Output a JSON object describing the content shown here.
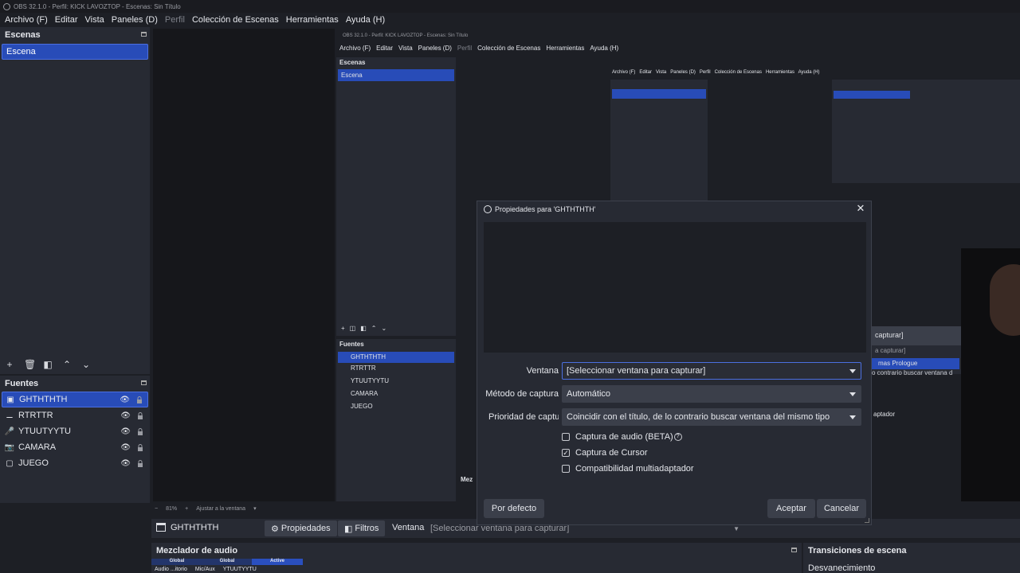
{
  "window_title": "OBS 32.1.0 - Perfil: KICK LAVOZTOP - Escenas: Sin Título",
  "menu": [
    "Archivo (F)",
    "Editar",
    "Vista",
    "Paneles (D)",
    "Perfil",
    "Colección de Escenas",
    "Herramientas",
    "Ayuda (H)"
  ],
  "scenes": {
    "title": "Escenas",
    "items": [
      "Escena"
    ]
  },
  "sources": {
    "title": "Fuentes",
    "items": [
      {
        "name": "GHTHTHTH",
        "icon": "window-icon",
        "selected": true
      },
      {
        "name": "RTRTTR",
        "icon": "gamepad-icon",
        "selected": false
      },
      {
        "name": "YTUUTYYTU",
        "icon": "microphone-icon",
        "selected": false
      },
      {
        "name": "CAMARA",
        "icon": "camera-icon",
        "selected": false
      },
      {
        "name": "JUEGO",
        "icon": "monitor-icon",
        "selected": false
      }
    ]
  },
  "nested": {
    "title": "OBS 32.1.0 - Perfil: KICK LAVOZTOP - Escenas: Sin Título",
    "menu": [
      "Archivo (F)",
      "Editar",
      "Vista",
      "Paneles (D)",
      "Perfil",
      "Colección de Escenas",
      "Herramientas",
      "Ayuda (H)"
    ],
    "scenes_title": "Escenas",
    "scene_item": "Escena",
    "sources_title": "Fuentes",
    "sources": [
      "GHTHTHTH",
      "RTRTTR",
      "YTUUTYYTU",
      "CAMARA",
      "JUEGO"
    ],
    "dropdown_fragment": "capturar]",
    "dropdown_option_1": "a capturar]",
    "dropdown_option_2": "mas Prologue",
    "dropdown_option_3": "o contrario buscar ventana d",
    "mixer_fragment": "Mez",
    "adapter_fragment": "aptador"
  },
  "dialog": {
    "title": "Propiedades para 'GHTHTHTH'",
    "fields": [
      {
        "label": "Ventana",
        "value": "[Seleccionar ventana para capturar]"
      },
      {
        "label": "Método de captura",
        "value": "Automático"
      },
      {
        "label": "Prioridad de captura",
        "value": "Coincidir con el título, de lo contrario buscar ventana del mismo tipo"
      }
    ],
    "checkboxes": [
      {
        "label": "Captura de audio (BETA)",
        "checked": false,
        "help": true
      },
      {
        "label": "Captura de Cursor",
        "checked": true,
        "help": false
      },
      {
        "label": "Compatibilidad multiadaptador",
        "checked": false,
        "help": false
      }
    ],
    "defaults_button": "Por defecto",
    "accept_button": "Aceptar",
    "cancel_button": "Cancelar"
  },
  "zoom": {
    "level": "81%",
    "fit": "Ajustar a la ventana"
  },
  "source_bar": {
    "name": "GHTHTHTH",
    "properties": "Propiedades",
    "filters": "Filtros",
    "window_label": "Ventana",
    "window_value": "[Seleccionar ventana para capturar]"
  },
  "mixer": {
    "title": "Mezclador de audio",
    "headers": [
      "Global",
      "Global",
      "Active"
    ],
    "channels": [
      "Audio ...itorio",
      "Mic/Aux",
      "YTUUTYYTU"
    ]
  },
  "transitions": {
    "title": "Transiciones de escena",
    "value": "Desvanecimiento"
  },
  "colors": {
    "accent": "#284cb8",
    "panel": "#272a33",
    "background": "#1d1f25"
  }
}
